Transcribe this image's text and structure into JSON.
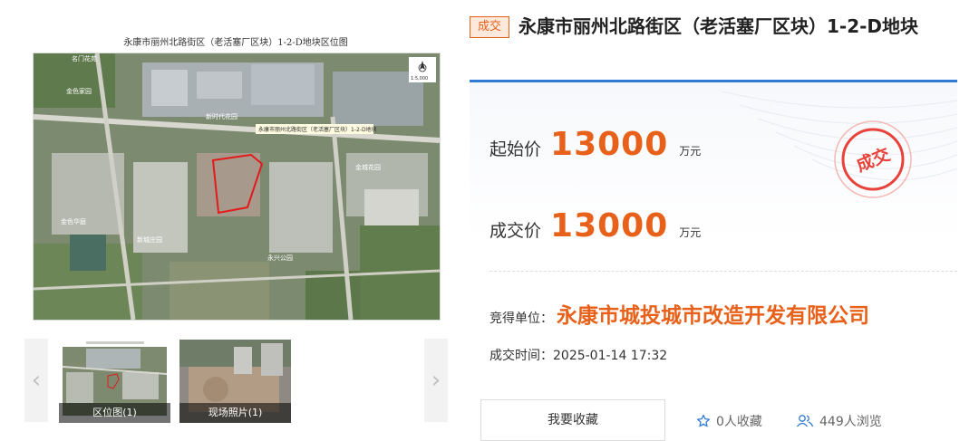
{
  "gallery": {
    "map_title": "永康市丽州北路街区（老活塞厂区块）1-2-D地块区位图",
    "map_scale": "1:5,000",
    "map_overlay_label": "永康市丽州北路街区（老活塞厂区块）1-2-D地块",
    "map_place_labels": [
      "名门花苑",
      "金色家园",
      "新时代花园",
      "金色华庭",
      "金城花园",
      "新城庄园",
      "永兴公园"
    ],
    "thumbnails": [
      {
        "caption": "区位图(1)"
      },
      {
        "caption": "现场照片(1)"
      }
    ],
    "prev_icon": "‹",
    "next_icon": "›"
  },
  "land": {
    "status": "成交",
    "title": "永康市丽州北路街区（老活塞厂区块）1-2-D地块"
  },
  "price": {
    "start_label": "起始价",
    "start_value": "13000",
    "start_unit": "万元",
    "deal_label": "成交价",
    "deal_value": "13000",
    "deal_unit": "万元",
    "stamp_text": "成交"
  },
  "winner": {
    "label": "竞得单位：",
    "value": "永康市城投城市改造开发有限公司"
  },
  "deal_time": "成交时间：2025-01-14 17:32",
  "actions": {
    "favorite_button": "我要收藏",
    "favorites_count": "0人收藏",
    "views_count": "449人浏览"
  },
  "colors": {
    "accent": "#e8611a",
    "panel_border": "#2f7bd6"
  },
  "icons": [
    "star-icon",
    "users-icon",
    "chevron-left-icon",
    "chevron-right-icon",
    "compass-icon",
    "stamp-icon"
  ]
}
